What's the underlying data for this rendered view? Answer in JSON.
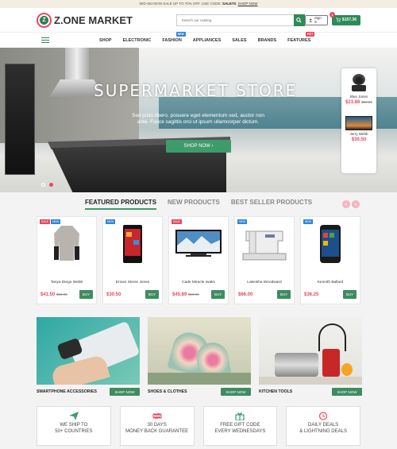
{
  "topbar": {
    "text": "MID-SEASON SALE UP TO 70% OFF. USE CODE:",
    "code": "SALE70",
    "link": "SHOP NOW"
  },
  "header": {
    "logo_text": "Z.ONE MARKET",
    "logo_letter": "Z",
    "search_placeholder": "Search our catalog",
    "signin_label": "Sign in",
    "cart_total": "$157.36",
    "cart_count": "1"
  },
  "nav": {
    "items": [
      {
        "label": "SHOP"
      },
      {
        "label": "ELECTRONIC"
      },
      {
        "label": "FASHION",
        "badge": "NEW",
        "badge_color": "#2e86de"
      },
      {
        "label": "APPLIANCES"
      },
      {
        "label": "SALES"
      },
      {
        "label": "BRANDS"
      },
      {
        "label": "FEATURES",
        "badge": "HOT",
        "badge_color": "#e84a5f"
      }
    ]
  },
  "hero": {
    "title": "SUPERMARKET STORE",
    "subtitle": "Sed justo libero, posuere eget elementum sed, auctor non ante. Fusce sagittis orci ut ipsum ullamcorper dictum.",
    "button": "SHOP NOW",
    "side_products": [
      {
        "name": "Blue Jones",
        "price": "$23.86",
        "old_price": "$26.51"
      },
      {
        "name": "Jerry Webb",
        "price": "$30.50",
        "old_price": ""
      }
    ]
  },
  "tabs": [
    {
      "label": "FEATURED PRODUCTS",
      "active": true
    },
    {
      "label": "NEW PRODUCTS",
      "active": false
    },
    {
      "label": "BEST SELLER PRODUCTS",
      "active": false
    }
  ],
  "products": [
    {
      "name": "Tanya Diego Webb",
      "price": "$41.50",
      "old_price": "$58.90",
      "buy": "BUY",
      "badges": [
        "SALE",
        "NEW"
      ],
      "icon": "blouse-icon"
    },
    {
      "name": "Erown Stevie Jones",
      "price": "$30.50",
      "old_price": "",
      "buy": "BUY",
      "badges": [
        "NEW"
      ],
      "icon": "phone-icon"
    },
    {
      "name": "Cade Miracle Iwaks",
      "price": "$45.89",
      "old_price": "$50.99",
      "buy": "BUY",
      "badges": [
        "SALE"
      ],
      "icon": "tv-icon"
    },
    {
      "name": "Lakeisha Woodward",
      "price": "$66.00",
      "old_price": "",
      "buy": "BUY",
      "badges": [
        "NEW"
      ],
      "icon": "sewing-machine-icon"
    },
    {
      "name": "Kennith Ballard",
      "price": "$36.25",
      "old_price": "",
      "buy": "BUY",
      "badges": [
        "NEW"
      ],
      "icon": "smartphone-icon"
    }
  ],
  "banners": [
    {
      "label": "SMARTPHONE ACCESSORIES",
      "button": "SHOP NOW"
    },
    {
      "label": "SHOES & CLOTHES",
      "button": "SHOP NOW"
    },
    {
      "label": "KITCHEN TOOLS",
      "button": "SHOP NOW"
    }
  ],
  "features": [
    {
      "line1": "WE SHIP TO",
      "line2": "50+ COUNTRIES",
      "icon": "paper-plane-icon"
    },
    {
      "line1": "30 DAYS",
      "line2": "MONEY BACK GUARANTEE",
      "icon": "refresh-icon"
    },
    {
      "line1": "FREE GIFT CODE",
      "line2": "EVERY WEDNESDAYS",
      "icon": "gift-icon"
    },
    {
      "line1": "DAILY DEALS",
      "line2": "& LIGHTNING DEALS",
      "icon": "clock-icon"
    }
  ],
  "colors": {
    "accent_green": "#3e9b6a",
    "accent_pink": "#e84a5f",
    "new_badge": "#2e86de"
  }
}
